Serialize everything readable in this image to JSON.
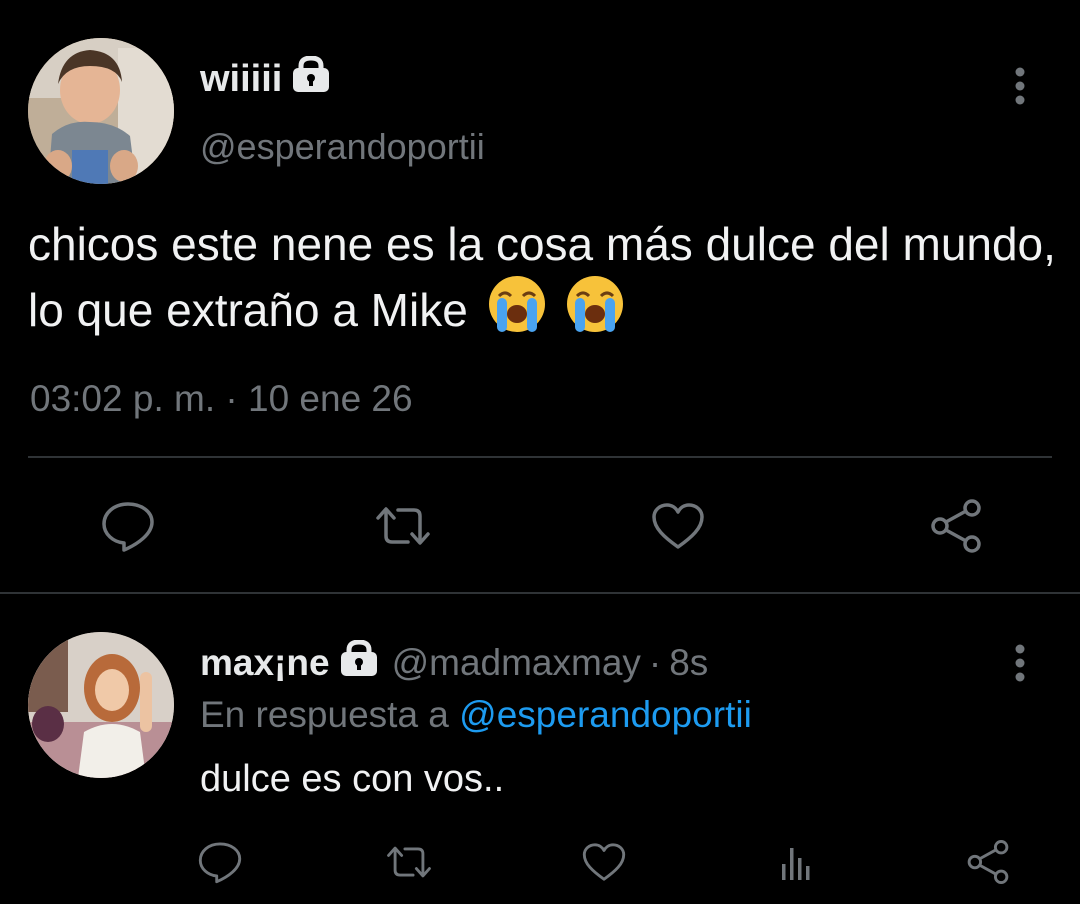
{
  "colors": {
    "background": "#000000",
    "text_primary": "#e7e9ea",
    "text_secondary": "#71767b",
    "accent": "#1d9bf0",
    "divider": "#2f3336"
  },
  "main_tweet": {
    "display_name": "wiiiii",
    "handle": "@esperandoportii",
    "text": "chicos este nene es la cosa más dulce del mundo, lo que extraño a Mike",
    "emojis": [
      "loudly-crying-face",
      "loudly-crying-face"
    ],
    "timestamp": "03:02 p. m. · 10 ene 26",
    "icons": [
      "lock-icon",
      "more-vertical-icon",
      "reply-icon",
      "retweet-icon",
      "like-icon",
      "share-icon"
    ]
  },
  "reply_tweet": {
    "display_name": "max¡ne",
    "handle": "@madmaxmay",
    "separator": "·",
    "time": "8s",
    "replying_to_prefix": "En respuesta a",
    "replying_to_handle": "@esperandoportii",
    "text": "dulce es con vos..",
    "icons": [
      "lock-icon",
      "more-vertical-icon",
      "reply-icon",
      "retweet-icon",
      "like-icon",
      "views-icon",
      "share-icon"
    ]
  }
}
